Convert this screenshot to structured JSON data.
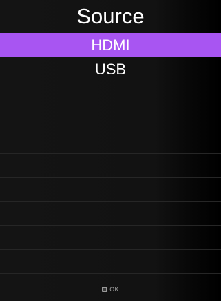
{
  "menu": {
    "title": "Source",
    "items": [
      {
        "label": "HDMI",
        "selected": true
      },
      {
        "label": "USB",
        "selected": false
      },
      {
        "label": "",
        "selected": false
      },
      {
        "label": "",
        "selected": false
      },
      {
        "label": "",
        "selected": false
      },
      {
        "label": "",
        "selected": false
      },
      {
        "label": "",
        "selected": false
      },
      {
        "label": "",
        "selected": false
      },
      {
        "label": "",
        "selected": false
      },
      {
        "label": "",
        "selected": false
      }
    ]
  },
  "footer": {
    "ok_icon": "ok-button-icon",
    "ok_label": "OK"
  },
  "colors": {
    "selection": "#a855f2",
    "text": "#ffffff"
  }
}
